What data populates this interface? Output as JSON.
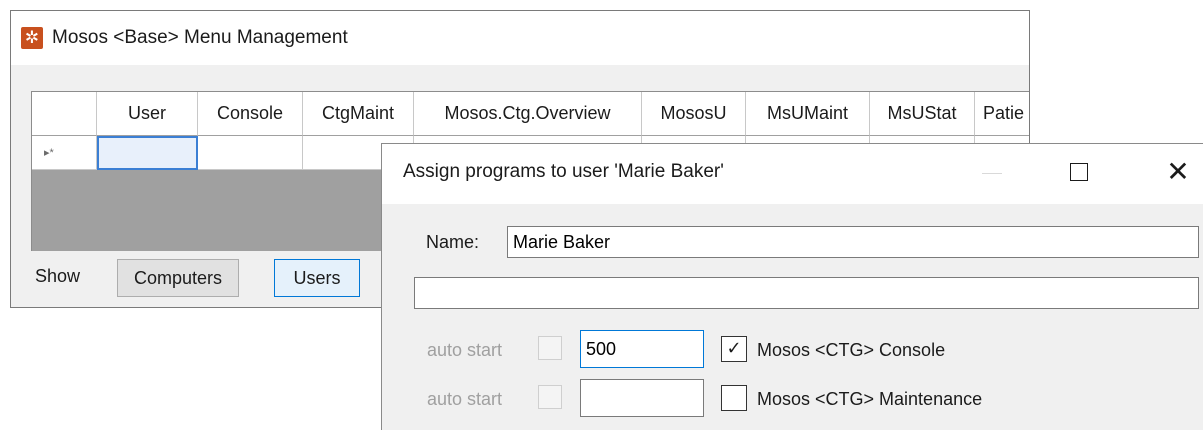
{
  "main_window": {
    "title": "Mosos <Base> Menu Management",
    "icon": "gear-icon",
    "grid": {
      "row_marker": "▸*",
      "columns": [
        "User",
        "Console",
        "CtgMaint",
        "Mosos.Ctg.Overview",
        "MososU",
        "MsUMaint",
        "MsUStat",
        "Patie"
      ]
    },
    "show_label": "Show",
    "buttons": {
      "computers": "Computers",
      "users": "Users"
    }
  },
  "dialog": {
    "title": "Assign programs to user 'Marie Baker'",
    "controls": {
      "maximize": "maximize-icon",
      "close_glyph": "✕"
    },
    "name_label": "Name:",
    "name_value": "Marie Baker",
    "description_value": "",
    "programs": [
      {
        "auto_start_label": "auto start",
        "auto_start_checked": false,
        "order": "500",
        "checked": true,
        "check_glyph": "✓",
        "label": "Mosos <CTG> Console"
      },
      {
        "auto_start_label": "auto start",
        "auto_start_checked": false,
        "order": "",
        "checked": false,
        "check_glyph": "",
        "label": "Mosos <CTG> Maintenance"
      }
    ]
  },
  "colors": {
    "accent": "#0078d7",
    "app_icon": "#c8501e",
    "grid_empty": "#a0a0a0",
    "disabled_text": "#a0a0a0"
  }
}
